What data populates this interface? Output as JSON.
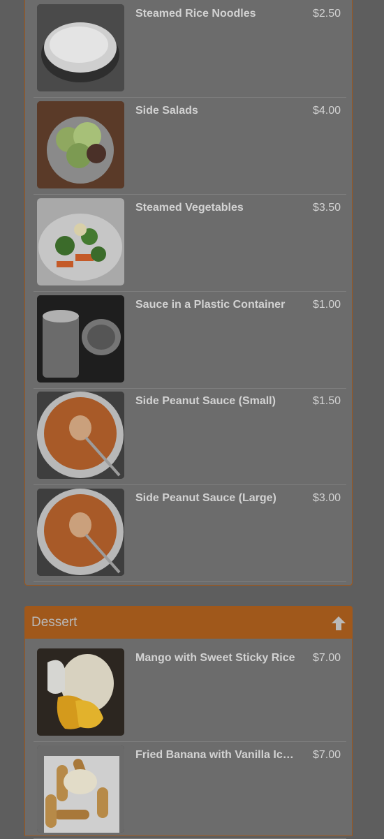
{
  "sides": {
    "items": [
      {
        "name": "Steamed Rice Noodles",
        "price": "$2.50"
      },
      {
        "name": "Side Salads",
        "price": "$4.00"
      },
      {
        "name": "Steamed Vegetables",
        "price": "$3.50"
      },
      {
        "name": "Sauce in a Plastic Container",
        "price": "$1.00"
      },
      {
        "name": "Side Peanut Sauce (Small)",
        "price": "$1.50"
      },
      {
        "name": "Side Peanut Sauce (Large)",
        "price": "$3.00"
      }
    ]
  },
  "dessert": {
    "title": "Dessert",
    "icon": "arrow-up-icon",
    "items": [
      {
        "name": "Mango with Sweet Sticky Rice",
        "price": "$7.00"
      },
      {
        "name": "Fried Banana with Vanilla Ice Cream",
        "price": "$7.00"
      }
    ]
  },
  "colors": {
    "accent": "#a0581b",
    "overlay_background": "#5e5e5e",
    "panel_background": "#6c6c6c"
  }
}
